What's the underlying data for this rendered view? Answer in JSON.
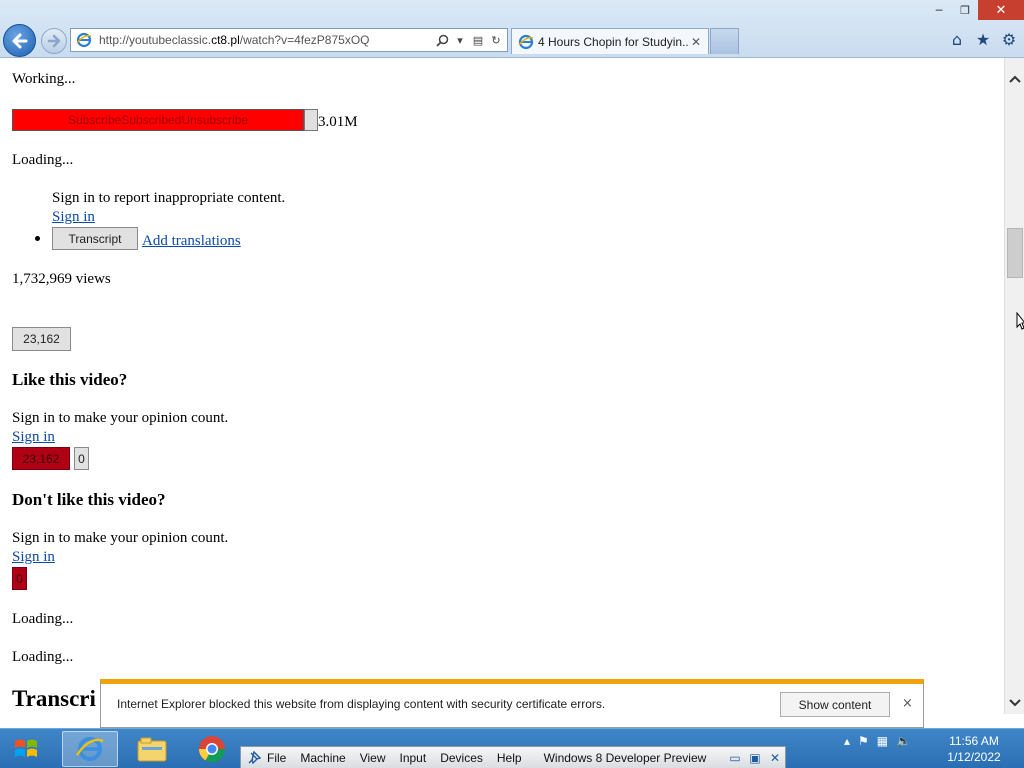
{
  "browser": {
    "url_plain": "http://youtubeclassic.",
    "url_domain": "ct8.pl",
    "url_path": "/watch?v=4fezP875xOQ",
    "tab_title": "4 Hours Chopin for Studyin...",
    "window_controls": {
      "minimize": "─",
      "restore": "❐",
      "close": "✕"
    }
  },
  "page": {
    "working_text": "Working...",
    "subscribe_label": "SubscribeSubscribedUnsubscribe",
    "subscriber_count": "3.01M",
    "loading_1": "Loading...",
    "report_text": "Sign in to report inappropriate content.",
    "report_sign_in": "Sign in",
    "transcript_button": "Transcript",
    "add_translations": "Add translations",
    "views": "1,732,969 views",
    "like_count_button": "23,162",
    "like_heading": "Like this video?",
    "like_prompt": "Sign in to make your opinion count.",
    "like_sign_in": "Sign in",
    "like_red_count": "23,162",
    "like_zero": "0",
    "dislike_heading": "Don't like this video?",
    "dislike_prompt": "Sign in to make your opinion count.",
    "dislike_sign_in": "Sign in",
    "dislike_red_count": "0",
    "loading_2": "Loading...",
    "loading_3": "Loading...",
    "transcript_heading": "Transcri"
  },
  "notification": {
    "message": "Internet Explorer blocked this website from displaying content with security certificate errors.",
    "button": "Show content",
    "close": "×"
  },
  "taskbar": {
    "vm_menus": [
      "File",
      "Machine",
      "View",
      "Input",
      "Devices",
      "Help"
    ],
    "vm_title": "Windows 8 Developer Preview",
    "time": "11:56 AM",
    "date": "1/12/2022"
  },
  "colors": {
    "subscribe_red": "#ff0000",
    "dark_red": "#b00015",
    "link_blue": "#0b4aa8",
    "notification_accent": "#f0a30a",
    "taskbar_blue": "#2a6fb3"
  }
}
